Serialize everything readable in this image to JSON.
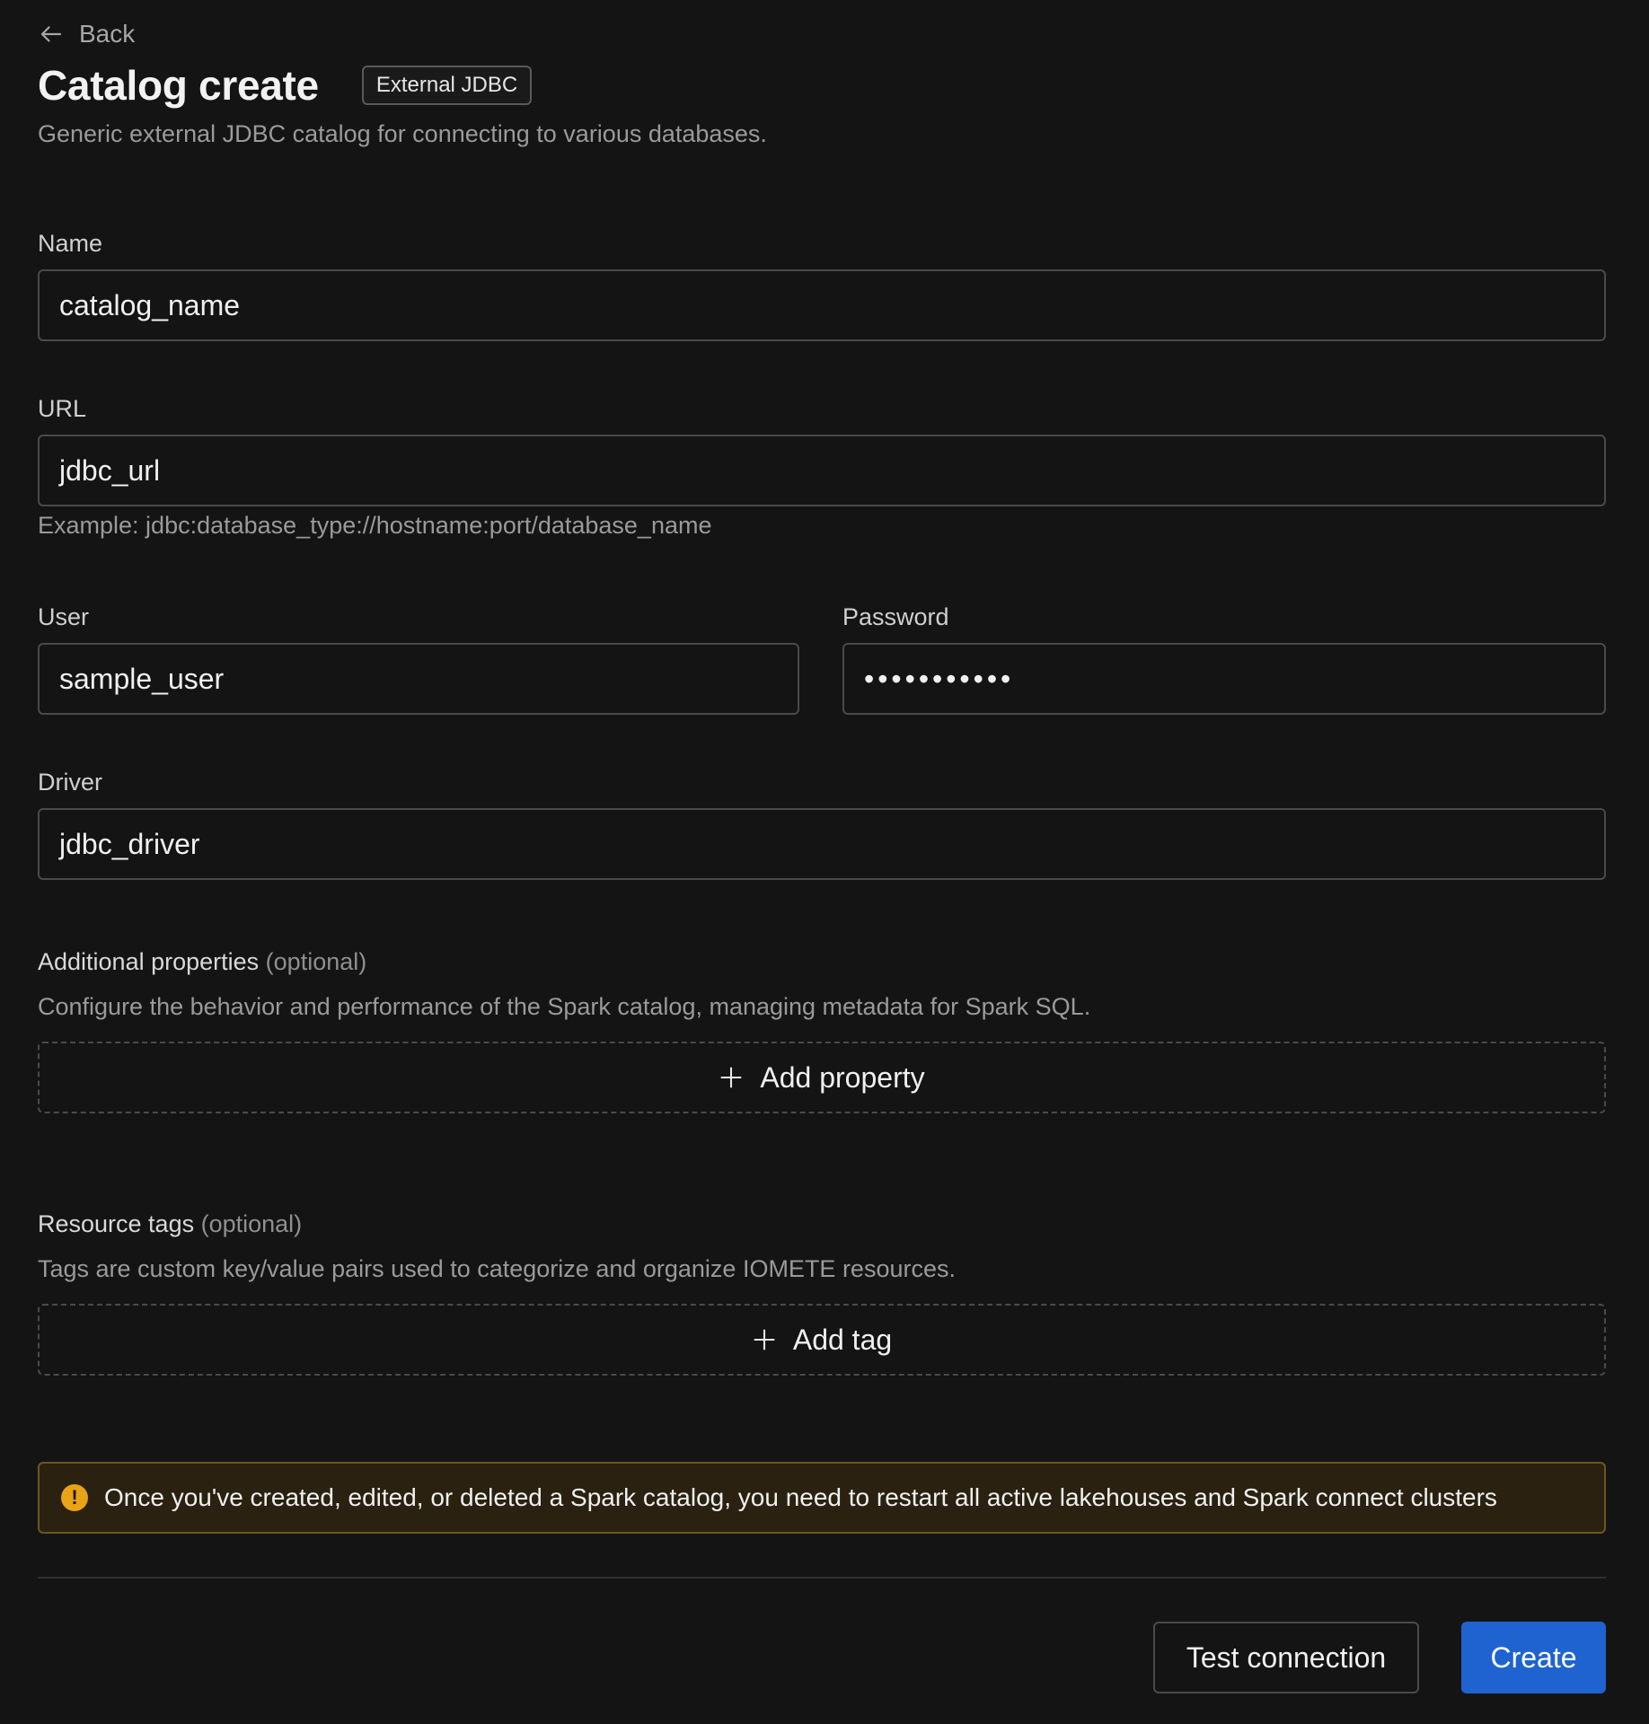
{
  "header": {
    "back_label": "Back",
    "title": "Catalog create",
    "badge": "External JDBC",
    "subtitle": "Generic external JDBC catalog for connecting to various databases."
  },
  "form": {
    "name": {
      "label": "Name",
      "value": "catalog_name"
    },
    "url": {
      "label": "URL",
      "value": "jdbc_url",
      "helper": "Example: jdbc:database_type://hostname:port/database_name"
    },
    "user": {
      "label": "User",
      "value": "sample_user"
    },
    "password": {
      "label": "Password",
      "value": "•••••••••••"
    },
    "driver": {
      "label": "Driver",
      "value": "jdbc_driver"
    }
  },
  "additional_properties": {
    "title": "Additional properties",
    "optional": "(optional)",
    "description": "Configure the behavior and performance of the Spark catalog, managing metadata for Spark SQL.",
    "add_label": "Add property"
  },
  "resource_tags": {
    "title": "Resource tags",
    "optional": "(optional)",
    "description": "Tags are custom key/value pairs used to categorize and organize IOMETE resources.",
    "add_label": "Add tag"
  },
  "alert": {
    "icon": "!",
    "text": "Once you've created, edited, or deleted a Spark catalog, you need to restart all active lakehouses and Spark connect clusters",
    "color": "#e8a317"
  },
  "actions": {
    "test_label": "Test connection",
    "create_label": "Create",
    "primary_color": "#1f63d1"
  }
}
